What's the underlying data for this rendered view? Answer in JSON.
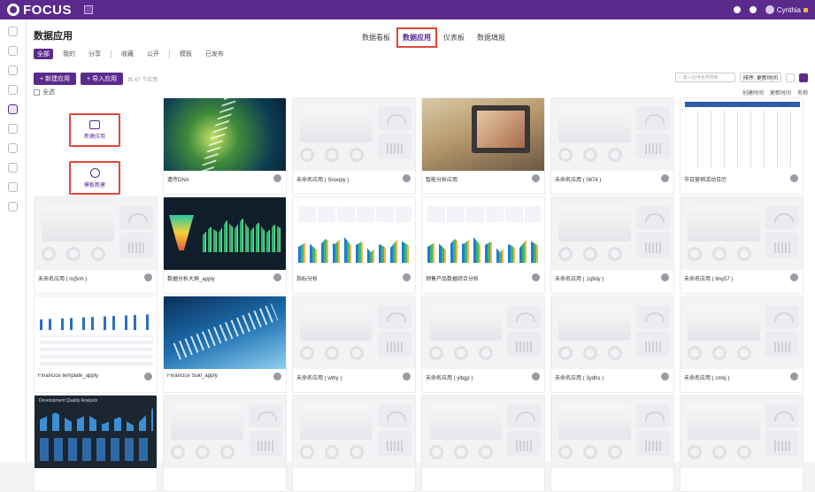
{
  "app": {
    "brand": "FOCUS",
    "user": "Cynthia"
  },
  "page": {
    "title": "数据应用",
    "tabs": [
      "数据看板",
      "数据应用",
      "仪表板",
      "数据填报"
    ],
    "active_tab_index": 1
  },
  "filters": [
    "全部",
    "我的",
    "分享",
    "收藏",
    "公开",
    "模板",
    "已发布"
  ],
  "actions": {
    "create_btn": "+ 新建应用",
    "import_btn": "+ 导入应用",
    "hint": "共 47 个应用",
    "select_all": "全选"
  },
  "toolbar": {
    "search_placeholder": "输入应用名称搜索",
    "sort_select": "排序: 更新时间",
    "sort_options": [
      "创建时间",
      "更新时间",
      "名称"
    ]
  },
  "create_card": {
    "blank_label": "新建应用",
    "template_label": "模板新建"
  },
  "cards": [
    {
      "caption": "遗传DNA"
    },
    {
      "caption": "未命名应用 ( Snoopy )"
    },
    {
      "caption": "智能分析应用"
    },
    {
      "caption": "未命名应用 ( 0874 )"
    },
    {
      "caption": "节日营销活动日历"
    },
    {
      "caption": "未命名应用 ( mj5nh )"
    },
    {
      "caption": "数据分析大屏_apply"
    },
    {
      "caption": "指标分析"
    },
    {
      "caption": "销售产品数据综合分析"
    },
    {
      "caption": "未命名应用 ( 1q9dy )"
    },
    {
      "caption": "未命名应用 ( 8ny57 )"
    },
    {
      "caption": "Financice template_apply"
    },
    {
      "caption": "Financice Sukl_apply"
    },
    {
      "caption": "未命名应用 ( wthy )"
    },
    {
      "caption": "未命名应用 ( ylbgp )"
    },
    {
      "caption": "未命名应用 ( 3ydhs )"
    },
    {
      "caption": "未命名应用 ( cmkj )"
    },
    {
      "caption": "Development Quality Analysis"
    },
    {
      "caption": ""
    },
    {
      "caption": ""
    },
    {
      "caption": ""
    },
    {
      "caption": ""
    },
    {
      "caption": ""
    }
  ],
  "colors": {
    "brand_purple": "#5b2a8c",
    "highlight_red": "#e0473a"
  }
}
